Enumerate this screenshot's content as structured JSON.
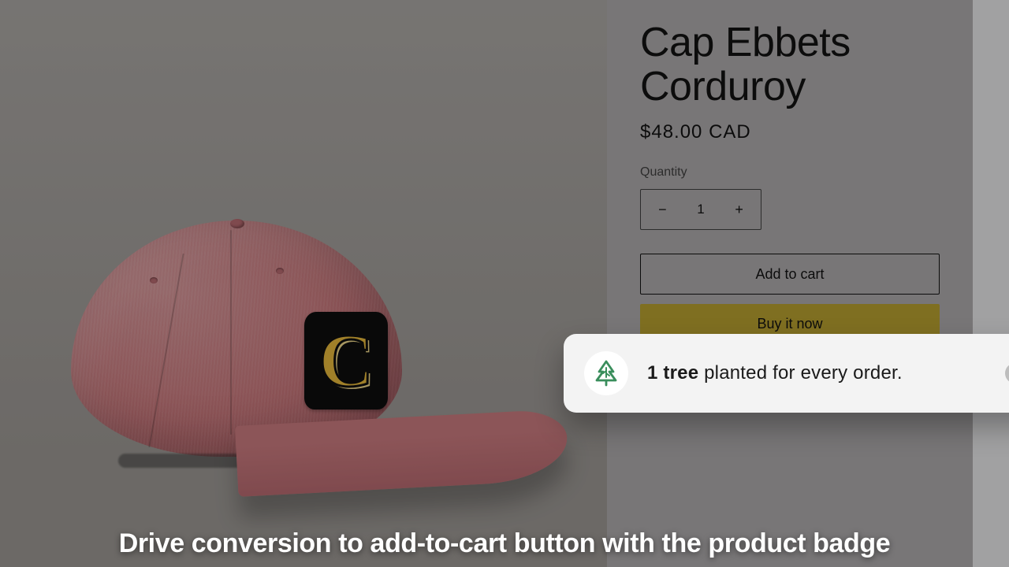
{
  "product": {
    "title": "Cap Ebbets Corduroy",
    "price": "$48.00 CAD",
    "quantity_label": "Quantity",
    "quantity_value": "1",
    "add_to_cart": "Add to cart",
    "buy_now": "Buy it now",
    "patch_letter": "C"
  },
  "badge": {
    "bold": "1 tree",
    "rest": " planted for every order."
  },
  "caption": "Drive conversion to add-to-cart button with the product badge"
}
